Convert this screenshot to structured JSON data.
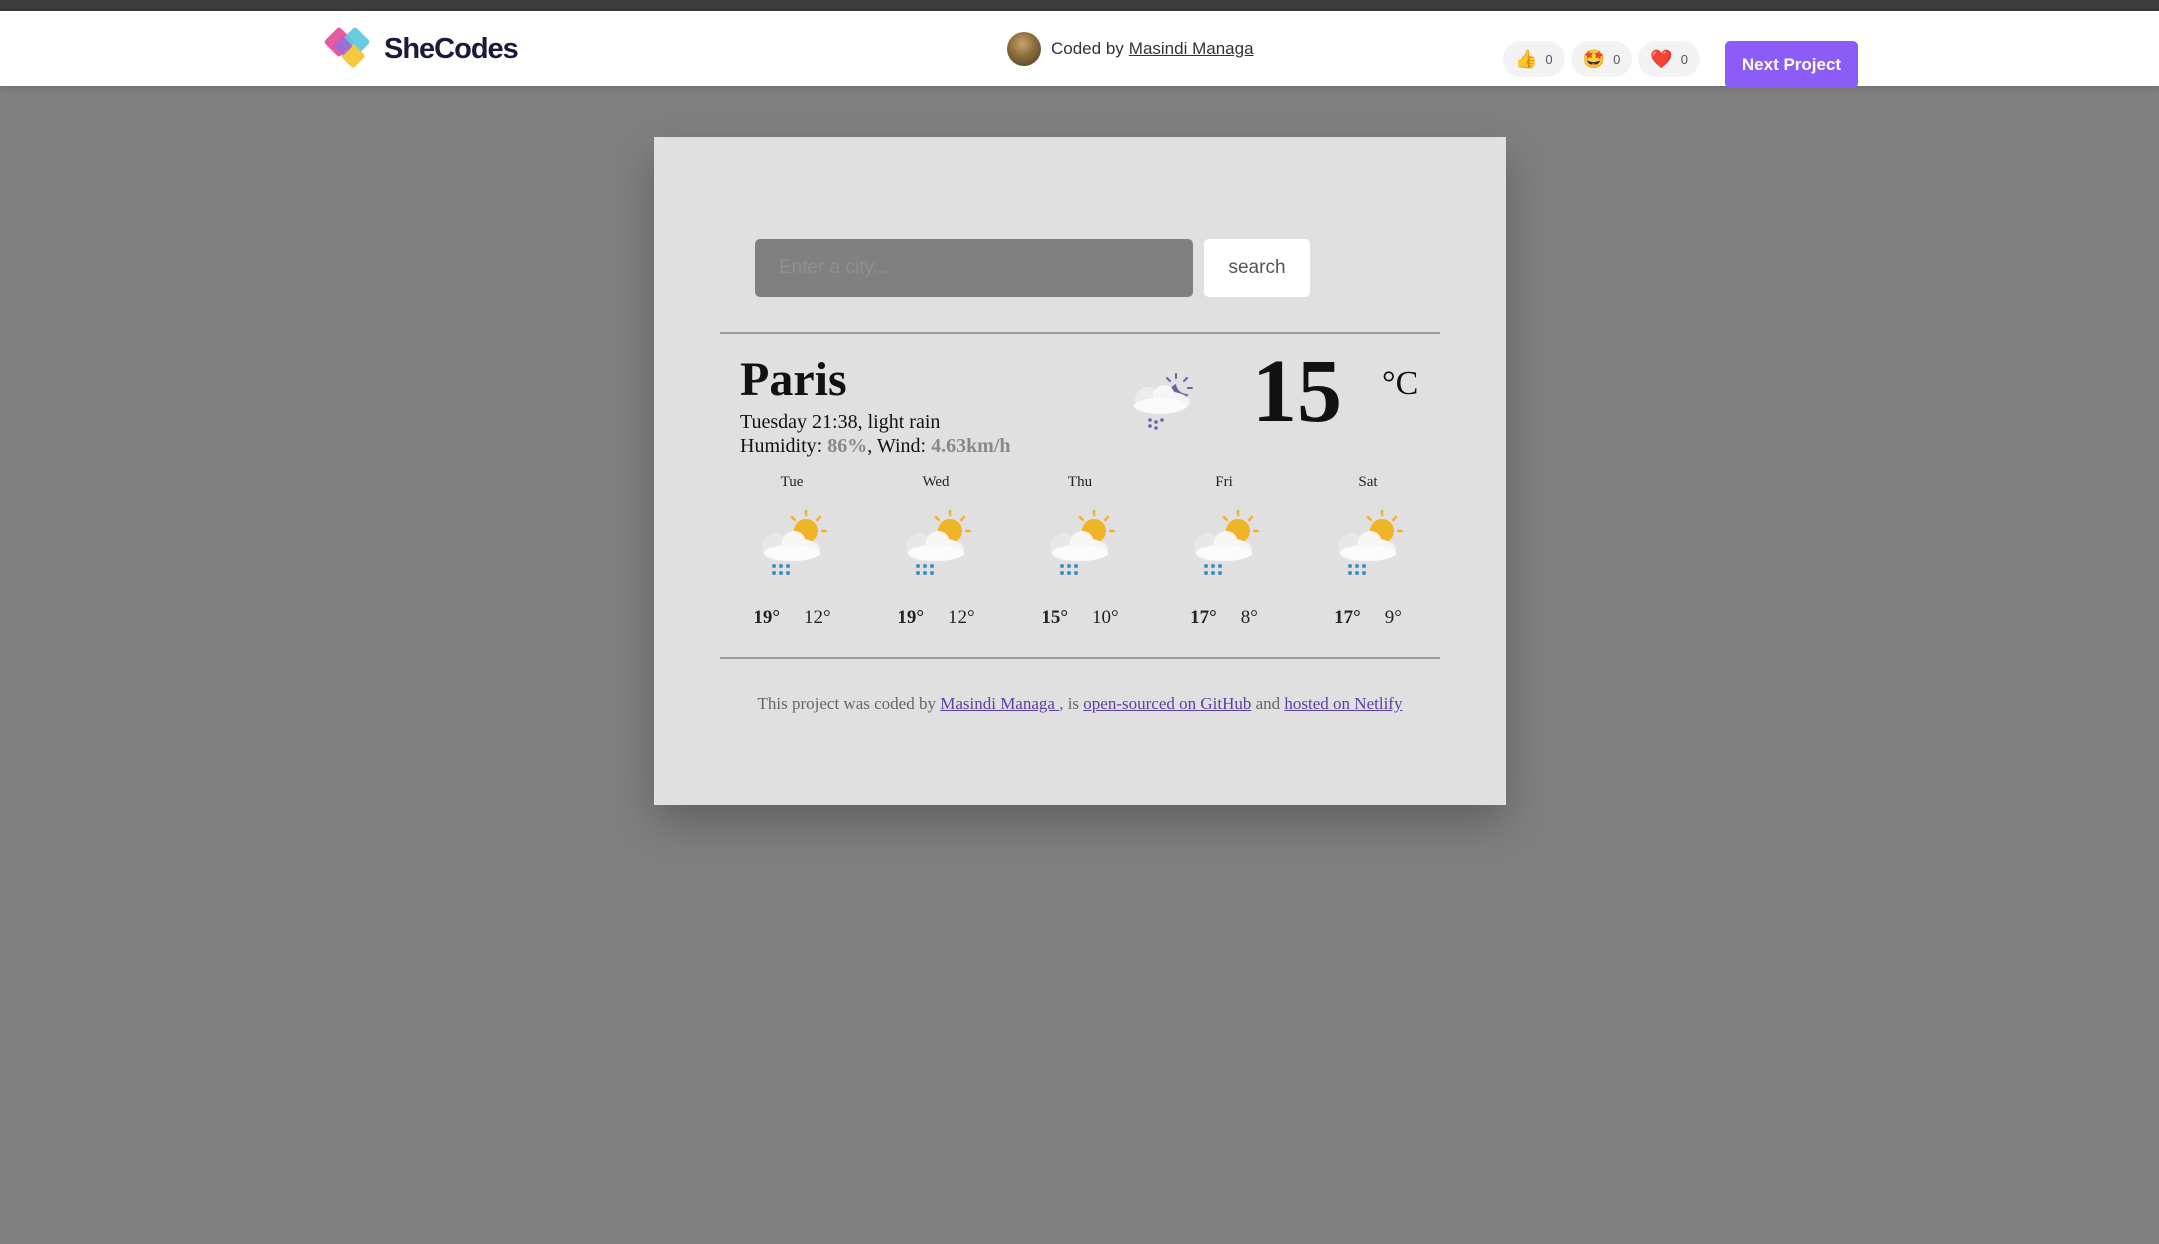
{
  "navbar": {
    "logo_text": "SheCodes",
    "coded_by_label": "Coded by",
    "author_name": "Masindi Managa",
    "reactions": [
      {
        "icon": "thumbs-up-icon",
        "glyph": "👍",
        "count": "0"
      },
      {
        "icon": "star-struck-icon",
        "glyph": "🤩",
        "count": "0"
      },
      {
        "icon": "heart-icon",
        "glyph": "❤️",
        "count": "0"
      }
    ],
    "next_label": "Next Project"
  },
  "search": {
    "placeholder": "Enter a city...",
    "value": "",
    "button_label": "search"
  },
  "current": {
    "city": "Paris",
    "datetime_desc": "Tuesday 21:38, light rain",
    "humidity_label": "Humidity: ",
    "humidity": "86%",
    "wind_label": ", Wind: ",
    "wind": "4.63km/h",
    "icon": "night-rain-cloud-icon",
    "temperature": "15",
    "unit": "°C"
  },
  "forecast": [
    {
      "day": "Tue",
      "max": "19°",
      "min": "12°",
      "icon": "sun-cloud-rain-icon"
    },
    {
      "day": "Wed",
      "max": "19°",
      "min": "12°",
      "icon": "sun-cloud-rain-icon"
    },
    {
      "day": "Thu",
      "max": "15°",
      "min": "10°",
      "icon": "sun-cloud-rain-icon"
    },
    {
      "day": "Fri",
      "max": "17°",
      "min": "8°",
      "icon": "sun-cloud-rain-icon"
    },
    {
      "day": "Sat",
      "max": "17°",
      "min": "9°",
      "icon": "sun-cloud-rain-icon"
    }
  ],
  "footer": {
    "text1": "This project was coded by ",
    "author_link": "Masindi Managa ",
    "text2": ", is ",
    "github_link": "open-sourced on GitHub",
    "text3": " and ",
    "netlify_link": "hosted on Netlify"
  },
  "colors": {
    "accent": "#8b5cf6",
    "page_bg": "#808080",
    "card_bg": "#e0e0e0",
    "link": "#5b3fa6"
  }
}
